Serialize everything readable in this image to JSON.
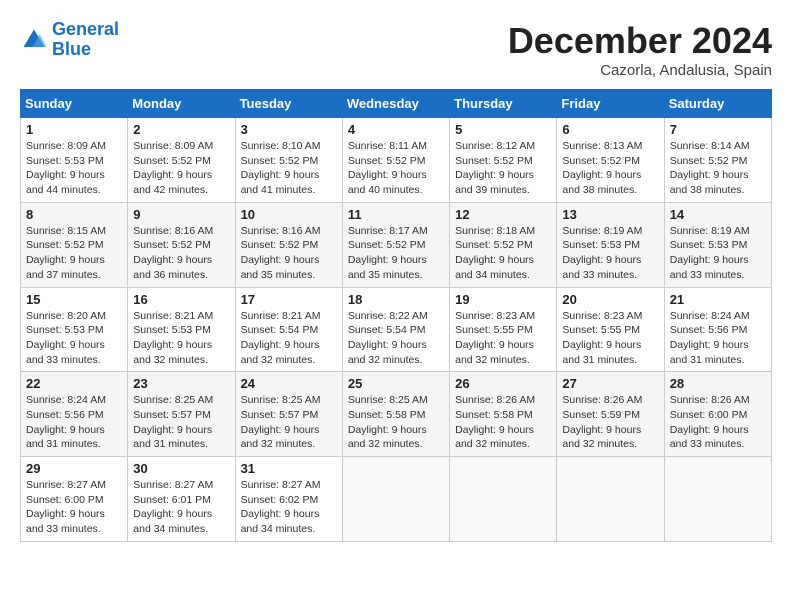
{
  "logo": {
    "line1": "General",
    "line2": "Blue"
  },
  "title": "December 2024",
  "location": "Cazorla, Andalusia, Spain",
  "days_header": [
    "Sunday",
    "Monday",
    "Tuesday",
    "Wednesday",
    "Thursday",
    "Friday",
    "Saturday"
  ],
  "weeks": [
    [
      {
        "day": "1",
        "sunrise": "8:09 AM",
        "sunset": "5:53 PM",
        "daylight": "9 hours and 44 minutes."
      },
      {
        "day": "2",
        "sunrise": "8:09 AM",
        "sunset": "5:52 PM",
        "daylight": "9 hours and 42 minutes."
      },
      {
        "day": "3",
        "sunrise": "8:10 AM",
        "sunset": "5:52 PM",
        "daylight": "9 hours and 41 minutes."
      },
      {
        "day": "4",
        "sunrise": "8:11 AM",
        "sunset": "5:52 PM",
        "daylight": "9 hours and 40 minutes."
      },
      {
        "day": "5",
        "sunrise": "8:12 AM",
        "sunset": "5:52 PM",
        "daylight": "9 hours and 39 minutes."
      },
      {
        "day": "6",
        "sunrise": "8:13 AM",
        "sunset": "5:52 PM",
        "daylight": "9 hours and 38 minutes."
      },
      {
        "day": "7",
        "sunrise": "8:14 AM",
        "sunset": "5:52 PM",
        "daylight": "9 hours and 38 minutes."
      }
    ],
    [
      {
        "day": "8",
        "sunrise": "8:15 AM",
        "sunset": "5:52 PM",
        "daylight": "9 hours and 37 minutes."
      },
      {
        "day": "9",
        "sunrise": "8:16 AM",
        "sunset": "5:52 PM",
        "daylight": "9 hours and 36 minutes."
      },
      {
        "day": "10",
        "sunrise": "8:16 AM",
        "sunset": "5:52 PM",
        "daylight": "9 hours and 35 minutes."
      },
      {
        "day": "11",
        "sunrise": "8:17 AM",
        "sunset": "5:52 PM",
        "daylight": "9 hours and 35 minutes."
      },
      {
        "day": "12",
        "sunrise": "8:18 AM",
        "sunset": "5:52 PM",
        "daylight": "9 hours and 34 minutes."
      },
      {
        "day": "13",
        "sunrise": "8:19 AM",
        "sunset": "5:53 PM",
        "daylight": "9 hours and 33 minutes."
      },
      {
        "day": "14",
        "sunrise": "8:19 AM",
        "sunset": "5:53 PM",
        "daylight": "9 hours and 33 minutes."
      }
    ],
    [
      {
        "day": "15",
        "sunrise": "8:20 AM",
        "sunset": "5:53 PM",
        "daylight": "9 hours and 33 minutes."
      },
      {
        "day": "16",
        "sunrise": "8:21 AM",
        "sunset": "5:53 PM",
        "daylight": "9 hours and 32 minutes."
      },
      {
        "day": "17",
        "sunrise": "8:21 AM",
        "sunset": "5:54 PM",
        "daylight": "9 hours and 32 minutes."
      },
      {
        "day": "18",
        "sunrise": "8:22 AM",
        "sunset": "5:54 PM",
        "daylight": "9 hours and 32 minutes."
      },
      {
        "day": "19",
        "sunrise": "8:23 AM",
        "sunset": "5:55 PM",
        "daylight": "9 hours and 32 minutes."
      },
      {
        "day": "20",
        "sunrise": "8:23 AM",
        "sunset": "5:55 PM",
        "daylight": "9 hours and 31 minutes."
      },
      {
        "day": "21",
        "sunrise": "8:24 AM",
        "sunset": "5:56 PM",
        "daylight": "9 hours and 31 minutes."
      }
    ],
    [
      {
        "day": "22",
        "sunrise": "8:24 AM",
        "sunset": "5:56 PM",
        "daylight": "9 hours and 31 minutes."
      },
      {
        "day": "23",
        "sunrise": "8:25 AM",
        "sunset": "5:57 PM",
        "daylight": "9 hours and 31 minutes."
      },
      {
        "day": "24",
        "sunrise": "8:25 AM",
        "sunset": "5:57 PM",
        "daylight": "9 hours and 32 minutes."
      },
      {
        "day": "25",
        "sunrise": "8:25 AM",
        "sunset": "5:58 PM",
        "daylight": "9 hours and 32 minutes."
      },
      {
        "day": "26",
        "sunrise": "8:26 AM",
        "sunset": "5:58 PM",
        "daylight": "9 hours and 32 minutes."
      },
      {
        "day": "27",
        "sunrise": "8:26 AM",
        "sunset": "5:59 PM",
        "daylight": "9 hours and 32 minutes."
      },
      {
        "day": "28",
        "sunrise": "8:26 AM",
        "sunset": "6:00 PM",
        "daylight": "9 hours and 33 minutes."
      }
    ],
    [
      {
        "day": "29",
        "sunrise": "8:27 AM",
        "sunset": "6:00 PM",
        "daylight": "9 hours and 33 minutes."
      },
      {
        "day": "30",
        "sunrise": "8:27 AM",
        "sunset": "6:01 PM",
        "daylight": "9 hours and 34 minutes."
      },
      {
        "day": "31",
        "sunrise": "8:27 AM",
        "sunset": "6:02 PM",
        "daylight": "9 hours and 34 minutes."
      },
      null,
      null,
      null,
      null
    ]
  ]
}
